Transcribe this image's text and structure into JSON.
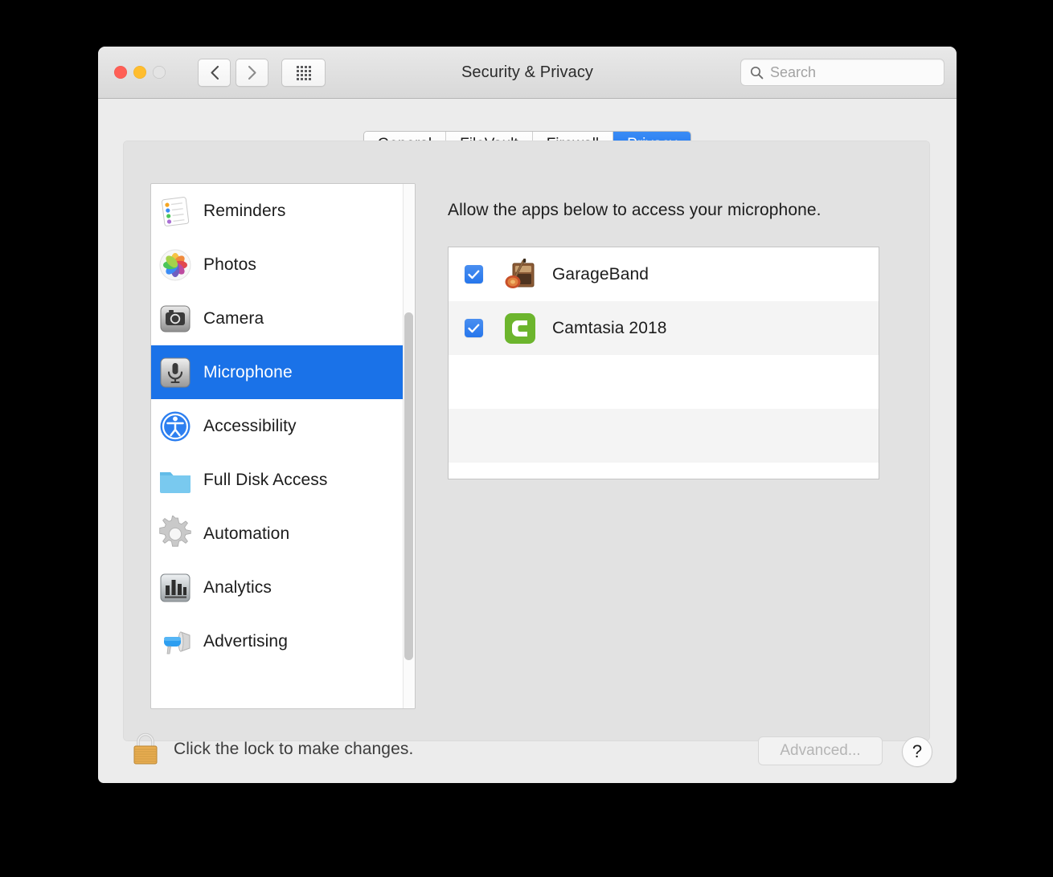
{
  "window": {
    "title": "Security & Privacy",
    "traffic_lights": [
      {
        "name": "close",
        "color": "#ff5f56"
      },
      {
        "name": "minimize",
        "color": "#ffbd2e"
      },
      {
        "name": "zoom",
        "color": "#e4e4e4"
      }
    ],
    "nav": {
      "back_icon": "chevron-left-icon",
      "forward_icon": "chevron-right-icon",
      "show_all_icon": "grid-dots-icon"
    }
  },
  "search": {
    "icon": "search-icon",
    "placeholder": "Search",
    "value": ""
  },
  "tabs": [
    {
      "label": "General",
      "active": false
    },
    {
      "label": "FileVault",
      "active": false
    },
    {
      "label": "Firewall",
      "active": false
    },
    {
      "label": "Privacy",
      "active": true
    }
  ],
  "sidebar": {
    "items": [
      {
        "label": "Reminders",
        "icon": "reminders-icon",
        "selected": false
      },
      {
        "label": "Photos",
        "icon": "photos-icon",
        "selected": false
      },
      {
        "label": "Camera",
        "icon": "camera-icon",
        "selected": false
      },
      {
        "label": "Microphone",
        "icon": "microphone-icon",
        "selected": true
      },
      {
        "label": "Accessibility",
        "icon": "accessibility-icon",
        "selected": false
      },
      {
        "label": "Full Disk Access",
        "icon": "folder-icon",
        "selected": false
      },
      {
        "label": "Automation",
        "icon": "gear-icon",
        "selected": false
      },
      {
        "label": "Analytics",
        "icon": "bar-chart-icon",
        "selected": false
      },
      {
        "label": "Advertising",
        "icon": "megaphone-icon",
        "selected": false
      }
    ],
    "scrollbar": "visible"
  },
  "content": {
    "heading": "Allow the apps below to access your microphone.",
    "apps": [
      {
        "name": "GarageBand",
        "checked": true,
        "icon": "garageband-icon"
      },
      {
        "name": "Camtasia 2018",
        "checked": true,
        "icon": "camtasia-icon"
      },
      {
        "name": "",
        "checked": false,
        "icon": ""
      },
      {
        "name": "",
        "checked": false,
        "icon": ""
      }
    ]
  },
  "footer": {
    "lock_icon": "lock-closed-icon",
    "lock_text": "Click the lock to make changes.",
    "advanced_label": "Advanced...",
    "advanced_enabled": false,
    "help_label": "?"
  },
  "colors": {
    "accent": "#1a72e8",
    "tab_active": "#2676ec",
    "window_bg": "#ececec",
    "panel_bg": "#e2e2e2",
    "list_bg": "#ffffff",
    "alt_row": "#f4f4f4",
    "checkbox": "#2676ec",
    "lock_gold": "#e8ad51"
  }
}
